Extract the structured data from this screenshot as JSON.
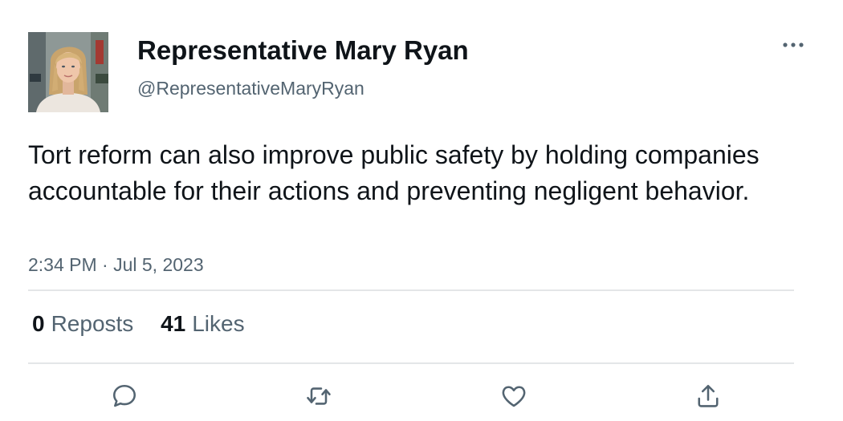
{
  "author": {
    "display_name": "Representative Mary Ryan",
    "handle": "@RepresentativeMaryRyan"
  },
  "tweet": {
    "text": "Tort reform can also improve public safety by holding companies accountable for their actions and preventing negligent behavior.",
    "timestamp": "2:34 PM · Jul 5, 2023"
  },
  "stats": {
    "reposts_count": "0",
    "reposts_label": "Reposts",
    "likes_count": "41",
    "likes_label": "Likes"
  },
  "icons": {
    "more": "more-horizontal-icon",
    "reply": "reply-bubble-icon",
    "repost": "repost-arrows-icon",
    "like": "heart-icon",
    "share": "share-upload-icon"
  },
  "colors": {
    "text_primary": "#0f1419",
    "text_secondary": "#536471",
    "divider": "#e4e6e8"
  }
}
